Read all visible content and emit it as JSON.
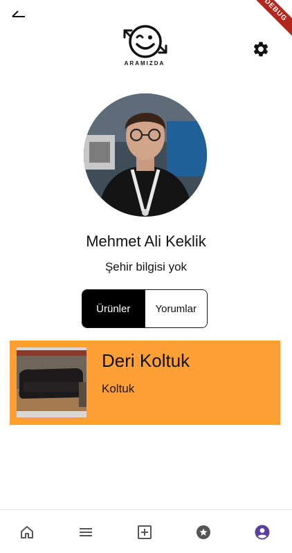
{
  "header": {
    "back_icon": "back-icon",
    "logo_text": "ARAMIZDA",
    "settings_icon": "gear-icon",
    "debug_banner": "DEBUG"
  },
  "profile": {
    "name": "Mehmet Ali Keklik",
    "city": "Şehir bilgisi yok"
  },
  "tabs": {
    "products_label": "Ürünler",
    "reviews_label": "Yorumlar",
    "selected": "Ürünler"
  },
  "products": [
    {
      "title": "Deri Koltuk",
      "category": "Koltuk"
    }
  ],
  "bottom_nav": {
    "items": [
      {
        "icon": "home-icon"
      },
      {
        "icon": "menu-icon"
      },
      {
        "icon": "add-box-icon"
      },
      {
        "icon": "star-circle-icon"
      },
      {
        "icon": "account-circle-icon"
      }
    ],
    "active_index": 4
  },
  "colors": {
    "card_bg": "#ffa037",
    "active_nav": "#5b3fa0",
    "inactive_nav": "#555555"
  }
}
